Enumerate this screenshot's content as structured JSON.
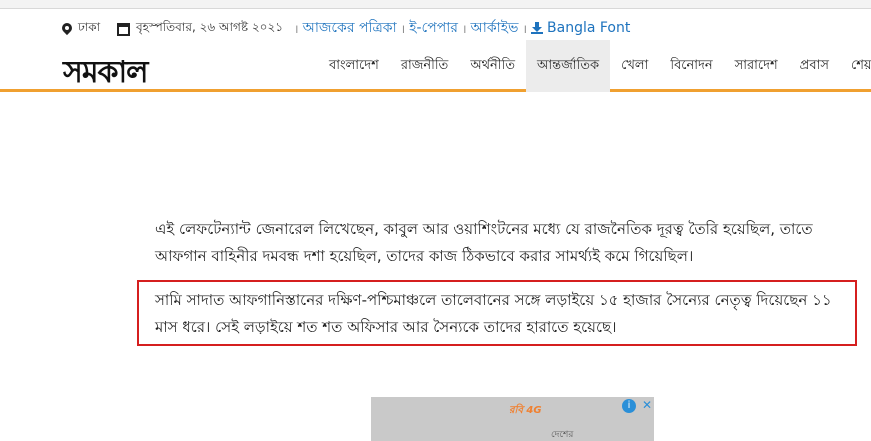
{
  "infobar": {
    "location": "ঢাকা",
    "date": "বৃহস্পতিবার, ২৬ আগষ্ট ২০২১",
    "links": [
      "আজকের পত্রিকা",
      "ই-পেপার",
      "আর্কাইভ",
      "Bangla Font"
    ],
    "separator": "।"
  },
  "header": {
    "logo": "সমকাল",
    "nav": [
      "বাংলাদেশ",
      "রাজনীতি",
      "অর্থনীতি",
      "আন্তর্জাতিক",
      "খেলা",
      "বিনোদন",
      "সারাদেশ",
      "প্রবাস",
      "শেয়া"
    ],
    "active_nav": "আন্তর্জাতিক"
  },
  "article": {
    "paragraph1": "এই লেফটেন্যান্ট জেনারেল লিখেছেন, কাবুল আর ওয়াশিংটনের মধ্যে যে রাজনৈতিক দূরত্ব তৈরি হয়েছিল, তাতে আফগান বাহিনীর দমবন্ধ দশা হয়েছিল, তাদের কাজ ঠিকভাবে করার সামর্থ্যই কমে গিয়েছিল।",
    "paragraph2": "সামি সাদাত আফগানিস্তানের দক্ষিণ-পশ্চিমাঞ্চলে তালেবানের সঙ্গে লড়াইয়ে ১৫ হাজার সৈন্যের নেতৃত্ব দিয়েছেন ১১ মাস ধরে। সেই লড়াইয়ে শত শত অফিসার আর সৈন্যকে তাদের হারাতে হয়েছে।"
  },
  "ad": {
    "brand": "রবি 4G",
    "choice_icon": "i",
    "close_icon": "✕",
    "caption": "দেশের"
  },
  "colors": {
    "link": "#1e73be",
    "nav_underline": "#f0a030",
    "highlight_border": "#d51f1f"
  }
}
